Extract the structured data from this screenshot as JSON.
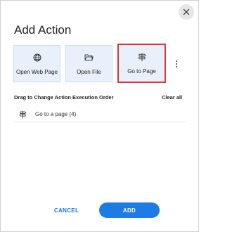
{
  "dialog": {
    "title": "Add Action",
    "close_icon": "close-icon"
  },
  "tiles": [
    {
      "label": "Open Web Page",
      "icon": "globe-icon",
      "selected": false
    },
    {
      "label": "Open File",
      "icon": "folder-icon",
      "selected": false
    },
    {
      "label": "Go to Page",
      "icon": "signpost-icon",
      "selected": true
    }
  ],
  "more_icon": "more-vertical-icon",
  "order_section": {
    "label": "Drag to Change Action Execution Order",
    "clear_all": "Clear all",
    "items": [
      {
        "label": "Go to a page (4)",
        "icon": "signpost-icon"
      }
    ]
  },
  "footer": {
    "cancel_label": "CANCEL",
    "add_label": "ADD"
  },
  "colors": {
    "accent": "#1e7be6",
    "selected_outline": "#e03236",
    "tile_bg": "#e8f1fb"
  }
}
